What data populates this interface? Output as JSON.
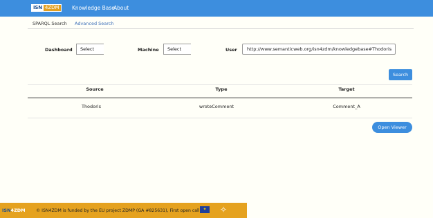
{
  "navbar": {
    "logo_part1": "ISN",
    "logo_part2": "4ZDM",
    "links": [
      "Knowledge Base",
      "About"
    ]
  },
  "tabs": [
    "SPARQL Search",
    "Advanced Search"
  ],
  "filters": {
    "dashboard_label": "Dashboard",
    "dashboard_value": "Select",
    "machine_label": "Machine",
    "machine_value": "Select",
    "user_label": "User",
    "user_value": "http://www.semanticweb.org/isn4zdm/knowledgebase#Thodoris"
  },
  "search_button": "Search",
  "table": {
    "headers": [
      "Source",
      "Type",
      "Target"
    ],
    "rows": [
      [
        "Thodoris",
        "wroteComment",
        "Comment_A"
      ]
    ]
  },
  "open_viewer_button": "Open Viewer",
  "footer": {
    "logo_part1": "ISN",
    "logo_part2": "4ZDM",
    "text": "© ISN4ZDM is funded by the EU project ZDMP (GA #825631), First open call",
    "eu_flag_icon": "eu-flag-icon",
    "zdmp_icon": "zdmp-logo-icon"
  },
  "colors": {
    "accent": "#3d8ede",
    "footer": "#e5a21f",
    "background": "#fffff8"
  }
}
